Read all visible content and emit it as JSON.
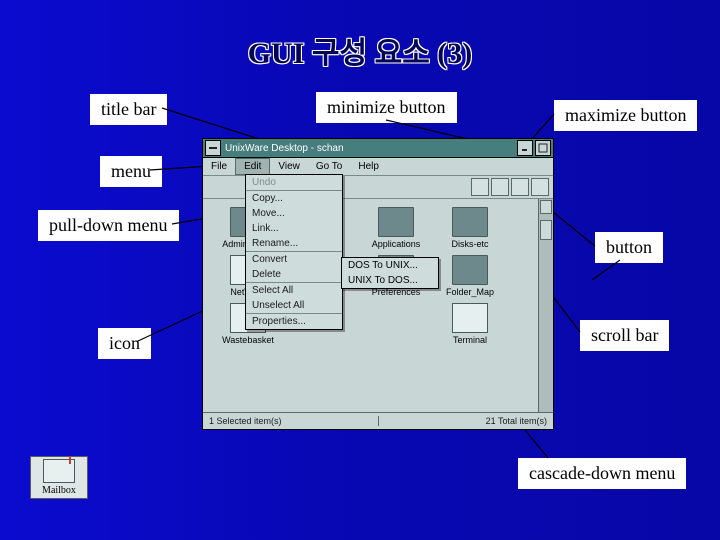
{
  "slide": {
    "title": "GUI 구성 요소 (3)"
  },
  "callouts": {
    "title_bar": "title bar",
    "menu": "menu",
    "pulldown_menu": "pull-down menu",
    "icon": "icon",
    "minimize_button": "minimize button",
    "maximize_button": "maximize button",
    "button": "button",
    "scroll_bar": "scroll bar",
    "cascade_down_menu": "cascade-down menu"
  },
  "window": {
    "title": "UnixWare Desktop - schan",
    "menubar": [
      "File",
      "Edit",
      "View",
      "Go To",
      "Help"
    ],
    "dropdown": [
      {
        "label": "Undo",
        "disabled": true
      },
      {
        "label": "Copy..."
      },
      {
        "label": "Move..."
      },
      {
        "label": "Link..."
      },
      {
        "label": "Rename..."
      },
      {
        "label": "Convert",
        "sep": true,
        "cascade": true
      },
      {
        "label": "Delete"
      },
      {
        "label": "Select All",
        "sep": true
      },
      {
        "label": "Unselect All"
      },
      {
        "label": "Properties...",
        "sep": true
      }
    ],
    "submenu": [
      "DOS To UNIX...",
      "UNIX To DOS..."
    ],
    "icons_row1": [
      {
        "label": "Admin_Tools",
        "type": "folder",
        "col": 0
      },
      {
        "label": "Applications",
        "type": "folder",
        "col": 2
      },
      {
        "label": "Disks-etc",
        "type": "folder",
        "col": 3
      }
    ],
    "icons_row2": [
      {
        "label": "NetWare",
        "type": "drive",
        "col": 0
      },
      {
        "label": "Preferences",
        "type": "folder",
        "col": 2
      },
      {
        "label": "Folder_Map",
        "type": "folder",
        "col": 3
      }
    ],
    "icons_row3": [
      {
        "label": "Wastebasket",
        "type": "drive",
        "col": 0
      },
      {
        "label": "Terminal",
        "type": "drive",
        "col": 3
      }
    ],
    "status_left": "1 Selected item(s)",
    "status_right": "21 Total item(s)"
  },
  "desktop_icon": {
    "label": "Mailbox"
  }
}
